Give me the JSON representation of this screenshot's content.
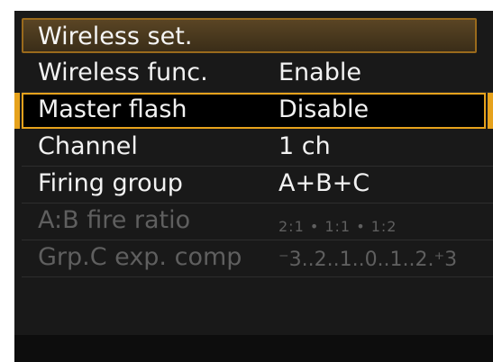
{
  "menu": {
    "title": "Wireless set.",
    "rows": [
      {
        "label": "Wireless func.",
        "value": "Enable",
        "state": "normal"
      },
      {
        "label": "Master flash",
        "value": "Disable",
        "state": "selected"
      },
      {
        "label": "Channel",
        "value": "1  ch",
        "state": "normal"
      },
      {
        "label": "Firing group",
        "value": "A+B+C",
        "state": "normal"
      },
      {
        "label": "A:B fire ratio",
        "value": "2:1  •  1:1  •  1:2",
        "state": "disabled"
      },
      {
        "label": "Grp.C exp. comp",
        "value": "⁻3..2..1..0..1..2.⁺3",
        "state": "disabled"
      }
    ]
  },
  "colors": {
    "accent": "#e6a21c",
    "background": "#191919",
    "text": "#f2f2f2",
    "dim_text": "#5f5f5f"
  }
}
